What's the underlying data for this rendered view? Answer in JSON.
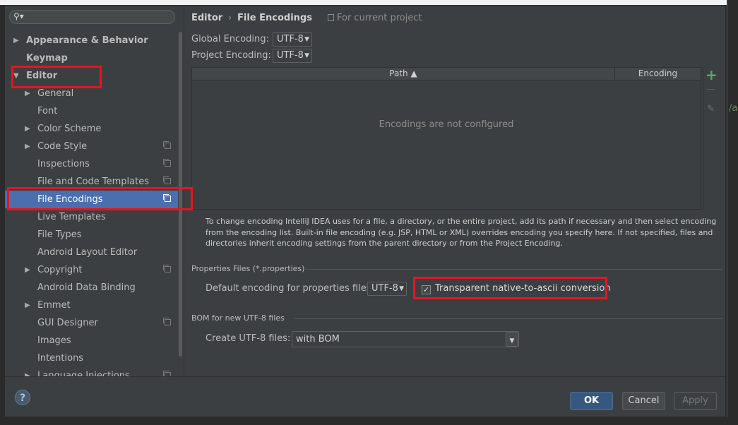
{
  "search": {
    "placeholder": ""
  },
  "sidebar": {
    "items": [
      {
        "label": "Appearance & Behavior",
        "arrow": "▶",
        "bold": true,
        "depth": 0
      },
      {
        "label": "Keymap",
        "arrow": "",
        "bold": true,
        "depth": 0
      },
      {
        "label": "Editor",
        "arrow": "▼",
        "bold": true,
        "depth": 0
      },
      {
        "label": "General",
        "arrow": "▶",
        "depth": 1
      },
      {
        "label": "Font",
        "arrow": "",
        "depth": 1
      },
      {
        "label": "Color Scheme",
        "arrow": "▶",
        "depth": 1
      },
      {
        "label": "Code Style",
        "arrow": "▶",
        "depth": 1,
        "copy": true
      },
      {
        "label": "Inspections",
        "arrow": "",
        "depth": 1,
        "copy": true
      },
      {
        "label": "File and Code Templates",
        "arrow": "",
        "depth": 1,
        "copy": true
      },
      {
        "label": "File Encodings",
        "arrow": "",
        "depth": 1,
        "copy": true,
        "selected": true
      },
      {
        "label": "Live Templates",
        "arrow": "",
        "depth": 1
      },
      {
        "label": "File Types",
        "arrow": "",
        "depth": 1
      },
      {
        "label": "Android Layout Editor",
        "arrow": "",
        "depth": 1
      },
      {
        "label": "Copyright",
        "arrow": "▶",
        "depth": 1,
        "copy": true
      },
      {
        "label": "Android Data Binding",
        "arrow": "",
        "depth": 1
      },
      {
        "label": "Emmet",
        "arrow": "▶",
        "depth": 1
      },
      {
        "label": "GUI Designer",
        "arrow": "",
        "depth": 1,
        "copy": true
      },
      {
        "label": "Images",
        "arrow": "",
        "depth": 1
      },
      {
        "label": "Intentions",
        "arrow": "",
        "depth": 1
      },
      {
        "label": "Language Injections",
        "arrow": "▶",
        "depth": 1,
        "copy": true
      }
    ]
  },
  "breadcrumb": {
    "parent": "Editor",
    "separator": "›",
    "current": "File Encodings",
    "scope": "For current project"
  },
  "global_encoding": {
    "label": "Global Encoding:",
    "value": "UTF-8"
  },
  "project_encoding": {
    "label": "Project Encoding:",
    "value": "UTF-8"
  },
  "table": {
    "columns": [
      "Path ▲",
      "Encoding"
    ],
    "empty_message": "Encodings are not configured"
  },
  "help_text": "To change encoding IntelliJ IDEA uses for a file, a directory, or the entire project, add its path if necessary and then select encoding from the encoding list. Built-in file encoding (e.g. JSP, HTML or XML) overrides encoding you specify here. If not specified, files and directories inherit encoding settings from the parent directory or from the Project Encoding.",
  "properties": {
    "section_title": "Properties Files (*.properties)",
    "default_label": "Default encoding for properties files:",
    "default_value": "UTF-8",
    "checkbox_label": "Transparent native-to-ascii conversion",
    "checkbox_checked": true
  },
  "bom": {
    "section_title": "BOM for new UTF-8 files",
    "label": "Create UTF-8 files:",
    "value": "with BOM"
  },
  "footer": {
    "help": "?",
    "ok": "OK",
    "cancel": "Cancel",
    "apply": "Apply"
  },
  "background_fragment": "/a",
  "colors": {
    "accent_selection": "#4b6eaf",
    "ok_button": "#365880",
    "highlight_box": "#e8141f",
    "add_icon": "#59a869"
  }
}
